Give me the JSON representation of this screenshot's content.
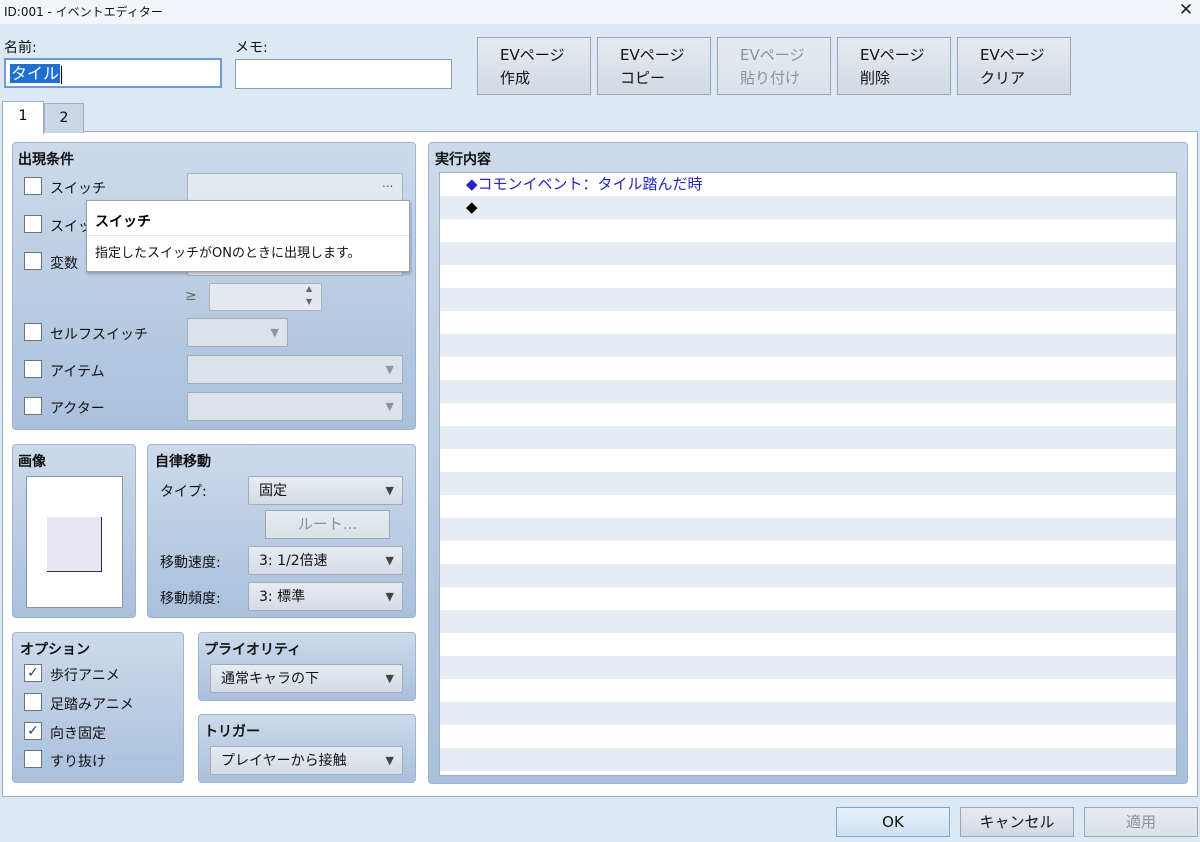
{
  "window": {
    "title": "ID:001 - イベントエディター",
    "close_glyph": "✕"
  },
  "name_field": {
    "label": "名前:",
    "value": "タイル"
  },
  "memo_field": {
    "label": "メモ:",
    "value": ""
  },
  "ev_buttons": [
    {
      "line1": "EVページ",
      "line2": "作成",
      "enabled": true
    },
    {
      "line1": "EVページ",
      "line2": "コピー",
      "enabled": true
    },
    {
      "line1": "EVページ",
      "line2": "貼り付け",
      "enabled": false
    },
    {
      "line1": "EVページ",
      "line2": "削除",
      "enabled": true
    },
    {
      "line1": "EVページ",
      "line2": "クリア",
      "enabled": true
    }
  ],
  "tabs": [
    {
      "label": "1",
      "active": true
    },
    {
      "label": "2",
      "active": false
    }
  ],
  "conditions": {
    "title": "出現条件",
    "switch1": {
      "label": "スイッチ",
      "checked": false,
      "button_glyph": "..."
    },
    "switch2": {
      "label": "スイッ",
      "checked": false
    },
    "variable": {
      "label": "変数",
      "checked": false,
      "ge_symbol": "≥"
    },
    "self_switch": {
      "label": "セルフスイッチ",
      "checked": false
    },
    "item": {
      "label": "アイテム",
      "checked": false
    },
    "actor": {
      "label": "アクター",
      "checked": false
    }
  },
  "tooltip": {
    "title": "スイッチ",
    "body": "指定したスイッチがONのときに出現します。"
  },
  "image_panel": {
    "title": "画像"
  },
  "autonomous": {
    "title": "自律移動",
    "type_label": "タイプ:",
    "type_value": "固定",
    "route_button": "ルート...",
    "speed_label": "移動速度:",
    "speed_value": "3: 1/2倍速",
    "freq_label": "移動頻度:",
    "freq_value": "3: 標準"
  },
  "options": {
    "title": "オプション",
    "items": [
      {
        "label": "歩行アニメ",
        "checked": true
      },
      {
        "label": "足踏みアニメ",
        "checked": false
      },
      {
        "label": "向き固定",
        "checked": true
      },
      {
        "label": "すり抜け",
        "checked": false
      }
    ]
  },
  "priority": {
    "title": "プライオリティ",
    "value": "通常キャラの下"
  },
  "trigger": {
    "title": "トリガー",
    "value": "プレイヤーから接触"
  },
  "contents": {
    "title": "実行内容",
    "commands": [
      "◆コモンイベント：タイル踏んだ時",
      "◆"
    ]
  },
  "footer": {
    "ok": "OK",
    "cancel": "キャンセル",
    "apply": "適用"
  },
  "symbols": {
    "check": "✓",
    "dropdown": "▼",
    "spin_up": "▲",
    "spin_down": "▼"
  }
}
